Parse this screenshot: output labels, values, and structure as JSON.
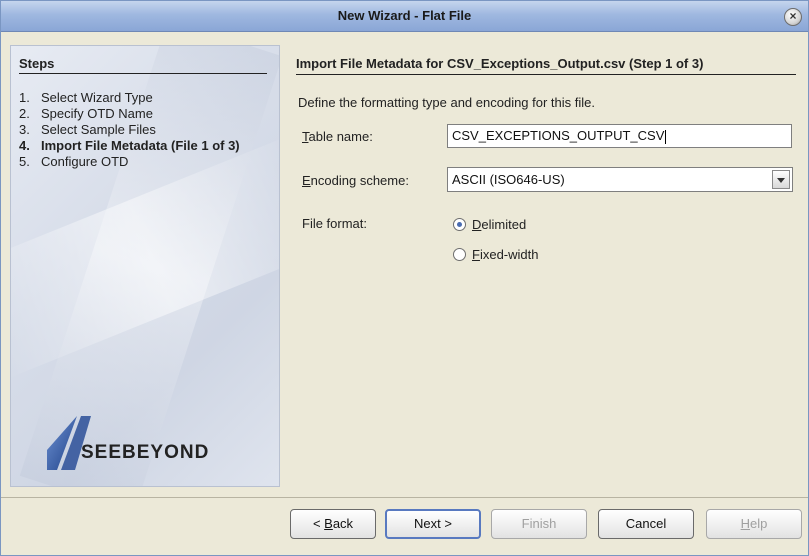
{
  "window": {
    "title": "New Wizard - Flat File"
  },
  "steps": {
    "header": "Steps",
    "items": [
      {
        "num": "1.",
        "label": "Select Wizard Type"
      },
      {
        "num": "2.",
        "label": "Specify OTD Name"
      },
      {
        "num": "3.",
        "label": "Select Sample Files"
      },
      {
        "num": "4.",
        "label": "Import File Metadata (File 1 of 3)"
      },
      {
        "num": "5.",
        "label": "Configure OTD"
      }
    ],
    "active_index": 3
  },
  "logo": {
    "text": "SeeBeyond",
    "display": "SEEBEYOND"
  },
  "main": {
    "title": "Import File Metadata for CSV_Exceptions_Output.csv (Step 1 of 3)",
    "intro": "Define the formatting type and encoding for this file.",
    "table_name": {
      "label_prefix": "T",
      "label_rest": "able name:",
      "value": "CSV_EXCEPTIONS_OUTPUT_CSV"
    },
    "encoding": {
      "label_prefix": "E",
      "label_rest": "ncoding scheme:",
      "value": "ASCII (ISO646-US)"
    },
    "file_format": {
      "label": "File format:",
      "options": [
        {
          "mn": "D",
          "rest": "elimited",
          "selected": true
        },
        {
          "mn": "F",
          "rest": "ixed-width",
          "selected": false
        }
      ]
    }
  },
  "buttons": {
    "back": {
      "pre": "< ",
      "mn": "B",
      "rest": "ack"
    },
    "next": "Next >",
    "finish": "Finish",
    "cancel": "Cancel",
    "help": {
      "mn": "H",
      "rest": "elp"
    }
  }
}
